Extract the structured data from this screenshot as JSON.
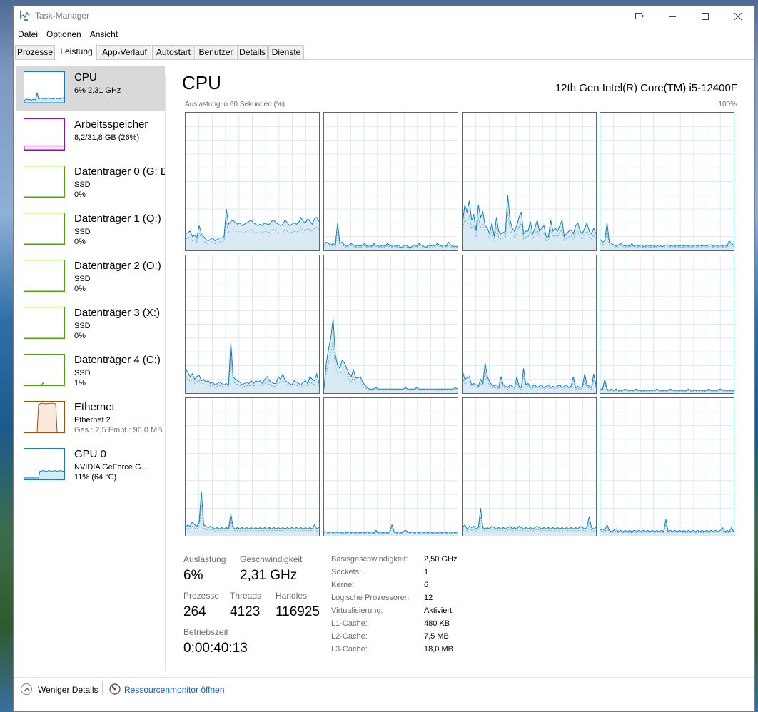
{
  "window": {
    "title": "Task-Manager"
  },
  "menu": [
    "Datei",
    "Optionen",
    "Ansicht"
  ],
  "tabs": [
    "Prozesse",
    "Leistung",
    "App-Verlauf",
    "Autostart",
    "Benutzer",
    "Details",
    "Dienste"
  ],
  "active_tab": "Leistung",
  "sidebar": {
    "items": [
      {
        "title": "CPU",
        "sub1": "6% 2,31 GHz",
        "sub2": "",
        "color": "#117dbb",
        "icon": "cpu-graph-icon",
        "level": 0.06
      },
      {
        "title": "Arbeitsspeicher",
        "sub1": "8,2/31,8 GB (26%)",
        "sub2": "",
        "color": "#8b12ae",
        "icon": "memory-graph-icon",
        "level": 0.26
      },
      {
        "title": "Datenträger 0 (G: D",
        "sub1": "SSD",
        "sub2": "0%",
        "color": "#4da60c",
        "icon": "disk-graph-icon",
        "level": 0
      },
      {
        "title": "Datenträger 1 (Q:)",
        "sub1": "SSD",
        "sub2": "0%",
        "color": "#4da60c",
        "icon": "disk-graph-icon",
        "level": 0
      },
      {
        "title": "Datenträger 2 (O:)",
        "sub1": "SSD",
        "sub2": "0%",
        "color": "#4da60c",
        "icon": "disk-graph-icon",
        "level": 0
      },
      {
        "title": "Datenträger 3 (X:)",
        "sub1": "SSD",
        "sub2": "0%",
        "color": "#4da60c",
        "icon": "disk-graph-icon",
        "level": 0
      },
      {
        "title": "Datenträger 4 (C:)",
        "sub1": "SSD",
        "sub2": "1%",
        "color": "#4da60c",
        "icon": "disk-graph-icon",
        "level": 0.01
      },
      {
        "title": "Ethernet",
        "sub1": "Ethernet 2",
        "sub2": "Ges.: 2,5  Empf.: 96,0 MB",
        "color": "#a74f01",
        "icon": "network-graph-icon"
      },
      {
        "title": "GPU 0",
        "sub1": "NVIDIA GeForce G...",
        "sub2": "11% (64 °C)",
        "color": "#117dbb",
        "icon": "gpu-graph-icon",
        "level": 0.11
      }
    ]
  },
  "main": {
    "title": "CPU",
    "model": "12th Gen Intel(R) Core(TM) i5-12400F",
    "axis_left": "Auslastung in 60 Sekunden (%)",
    "axis_right": "100%",
    "graph_color": "#117dbb",
    "graph_fill": "#d9eaf4",
    "grid_color": "#d9eaf4"
  },
  "stats": {
    "auslastung_label": "Auslastung",
    "auslastung": "6%",
    "geschwindigkeit_label": "Geschwindigkeit",
    "geschwindigkeit": "2,31 GHz",
    "prozesse_label": "Prozesse",
    "prozesse": "264",
    "threads_label": "Threads",
    "threads": "4123",
    "handles_label": "Handles",
    "handles": "116925",
    "betriebszeit_label": "Betriebszeit",
    "betriebszeit": "0:00:40:13"
  },
  "details": [
    {
      "label": "Basisgeschwindigkeit:",
      "value": "2,50 GHz"
    },
    {
      "label": "Sockets:",
      "value": "1"
    },
    {
      "label": "Kerne:",
      "value": "6"
    },
    {
      "label": "Logische Prozessoren:",
      "value": "12"
    },
    {
      "label": "Virtualisierung:",
      "value": "Aktiviert"
    },
    {
      "label": "L1-Cache:",
      "value": "480 KB"
    },
    {
      "label": "L2-Cache:",
      "value": "7,5 MB"
    },
    {
      "label": "L3-Cache:",
      "value": "18,0 MB"
    }
  ],
  "footer": {
    "fewer_details": "Weniger Details",
    "resource_monitor": "Ressourcenmonitor öffnen"
  },
  "chart_data": {
    "type": "area",
    "description_units": "percent CPU utilization per logical processor, 60 samples over 60 seconds",
    "ylim": [
      0,
      100
    ],
    "series": [
      {
        "name": "",
        "values": [
          12,
          13,
          14,
          10,
          11,
          9,
          18,
          12,
          10,
          8,
          7,
          8,
          9,
          7,
          8,
          9,
          9,
          10,
          30,
          19,
          21,
          22,
          20,
          19,
          20,
          18,
          19,
          20,
          21,
          22,
          20,
          19,
          18,
          19,
          18,
          20,
          19,
          19,
          21,
          22,
          20,
          19,
          18,
          19,
          22,
          20,
          18,
          19,
          20,
          19,
          20,
          24,
          21,
          20,
          23,
          21,
          19,
          23,
          24,
          21
        ]
      },
      {
        "name": "",
        "values": [
          5,
          6,
          5,
          4,
          5,
          4,
          20,
          5,
          6,
          4,
          3,
          4,
          5,
          4,
          3,
          4,
          3,
          4,
          5,
          3,
          4,
          3,
          5,
          4,
          3,
          3,
          4,
          3,
          5,
          4,
          3,
          4,
          3,
          4,
          2,
          3,
          4,
          3,
          2,
          3,
          4,
          3,
          5,
          4,
          3,
          2,
          4,
          3,
          4,
          3,
          5,
          4,
          3,
          4,
          3,
          6,
          4,
          3,
          3,
          3
        ]
      },
      {
        "name": "",
        "values": [
          20,
          33,
          28,
          36,
          22,
          26,
          14,
          33,
          24,
          28,
          18,
          16,
          12,
          20,
          10,
          24,
          14,
          12,
          13,
          14,
          40,
          22,
          16,
          14,
          18,
          24,
          28,
          12,
          14,
          14,
          21,
          12,
          16,
          22,
          14,
          16,
          18,
          10,
          10,
          22,
          14,
          16,
          14,
          18,
          22,
          10,
          12,
          14,
          15,
          12,
          18,
          20,
          14,
          12,
          16,
          20,
          14,
          12,
          16,
          12
        ]
      },
      {
        "name": "",
        "values": [
          8,
          6,
          7,
          20,
          6,
          5,
          4,
          3,
          4,
          5,
          4,
          3,
          4,
          3,
          5,
          3,
          4,
          3,
          4,
          3,
          3,
          4,
          3,
          4,
          3,
          3,
          4,
          3,
          3,
          4,
          4,
          3,
          4,
          3,
          4,
          3,
          4,
          3,
          4,
          3,
          4,
          3,
          4,
          3,
          4,
          3,
          4,
          3,
          4,
          4,
          3,
          4,
          3,
          4,
          3,
          4,
          3,
          7,
          5,
          4
        ]
      },
      {
        "name": "",
        "values": [
          18,
          15,
          12,
          14,
          10,
          12,
          13,
          9,
          10,
          8,
          9,
          7,
          8,
          6,
          7,
          8,
          7,
          6,
          7,
          6,
          37,
          12,
          10,
          9,
          8,
          6,
          7,
          8,
          7,
          9,
          7,
          9,
          8,
          9,
          7,
          10,
          12,
          9,
          8,
          7,
          7,
          12,
          10,
          14,
          9,
          8,
          7,
          6,
          9,
          8,
          7,
          6,
          8,
          9,
          7,
          12,
          10,
          9,
          14,
          7
        ]
      },
      {
        "name": "",
        "values": [
          4,
          22,
          32,
          40,
          54,
          28,
          20,
          18,
          24,
          22,
          18,
          14,
          12,
          17,
          11,
          11,
          12,
          8,
          6,
          4,
          3,
          3,
          3,
          4,
          3,
          3,
          3,
          3,
          3,
          3,
          3,
          3,
          3,
          3,
          3,
          3,
          4,
          3,
          3,
          3,
          3,
          4,
          3,
          3,
          3,
          3,
          3,
          3,
          3,
          3,
          3,
          3,
          3,
          3,
          3,
          3,
          3,
          3,
          4,
          3
        ]
      },
      {
        "name": "",
        "values": [
          16,
          10,
          11,
          12,
          6,
          7,
          6,
          5,
          10,
          7,
          22,
          12,
          8,
          6,
          5,
          6,
          4,
          12,
          6,
          5,
          4,
          6,
          5,
          4,
          12,
          5,
          4,
          18,
          6,
          7,
          4,
          5,
          6,
          4,
          5,
          6,
          4,
          5,
          6,
          4,
          5,
          4,
          5,
          6,
          4,
          5,
          6,
          4,
          5,
          12,
          4,
          5,
          4,
          5,
          14,
          6,
          5,
          4,
          14,
          6
        ]
      },
      {
        "name": "",
        "values": [
          3,
          3,
          10,
          3,
          2,
          3,
          2,
          3,
          2,
          2,
          2,
          3,
          2,
          2,
          2,
          2,
          3,
          2,
          2,
          2,
          2,
          2,
          2,
          2,
          2,
          3,
          2,
          2,
          2,
          2,
          2,
          3,
          2,
          2,
          2,
          2,
          2,
          2,
          2,
          3,
          2,
          2,
          2,
          2,
          2,
          2,
          2,
          2,
          3,
          2,
          2,
          2,
          2,
          3,
          2,
          2,
          2,
          2,
          2,
          2
        ]
      },
      {
        "name": "",
        "values": [
          6,
          8,
          7,
          10,
          8,
          7,
          10,
          32,
          8,
          7,
          6,
          7,
          6,
          5,
          6,
          5,
          6,
          5,
          6,
          5,
          16,
          6,
          5,
          6,
          5,
          6,
          5,
          6,
          5,
          6,
          5,
          6,
          5,
          6,
          5,
          6,
          5,
          6,
          5,
          6,
          5,
          6,
          5,
          6,
          5,
          6,
          5,
          6,
          5,
          6,
          5,
          6,
          5,
          6,
          5,
          6,
          5,
          8,
          5,
          6
        ]
      },
      {
        "name": "",
        "values": [
          3,
          3,
          2,
          3,
          2,
          3,
          2,
          3,
          2,
          3,
          2,
          3,
          2,
          3,
          2,
          3,
          2,
          3,
          2,
          3,
          2,
          3,
          2,
          4,
          2,
          3,
          2,
          3,
          2,
          3,
          8,
          3,
          2,
          3,
          2,
          3,
          4,
          3,
          2,
          3,
          2,
          3,
          2,
          3,
          2,
          3,
          2,
          3,
          2,
          3,
          2,
          3,
          2,
          3,
          2,
          3,
          2,
          3,
          2,
          3
        ]
      },
      {
        "name": "",
        "values": [
          6,
          8,
          5,
          7,
          6,
          7,
          5,
          6,
          20,
          6,
          5,
          6,
          5,
          7,
          6,
          5,
          6,
          5,
          6,
          5,
          6,
          7,
          5,
          6,
          5,
          7,
          6,
          5,
          6,
          5,
          6,
          5,
          6,
          7,
          6,
          5,
          6,
          5,
          6,
          5,
          6,
          5,
          6,
          5,
          6,
          5,
          6,
          5,
          6,
          5,
          6,
          5,
          7,
          6,
          5,
          6,
          14,
          6,
          5,
          6
        ]
      },
      {
        "name": "",
        "values": [
          4,
          5,
          4,
          8,
          4,
          3,
          4,
          5,
          3,
          4,
          3,
          4,
          3,
          4,
          3,
          4,
          3,
          4,
          3,
          4,
          3,
          4,
          3,
          4,
          3,
          4,
          3,
          4,
          3,
          12,
          3,
          4,
          3,
          4,
          3,
          4,
          3,
          4,
          3,
          4,
          3,
          4,
          3,
          4,
          3,
          4,
          3,
          4,
          3,
          4,
          3,
          4,
          3,
          4,
          6,
          3,
          4,
          3,
          6,
          3
        ]
      }
    ]
  }
}
